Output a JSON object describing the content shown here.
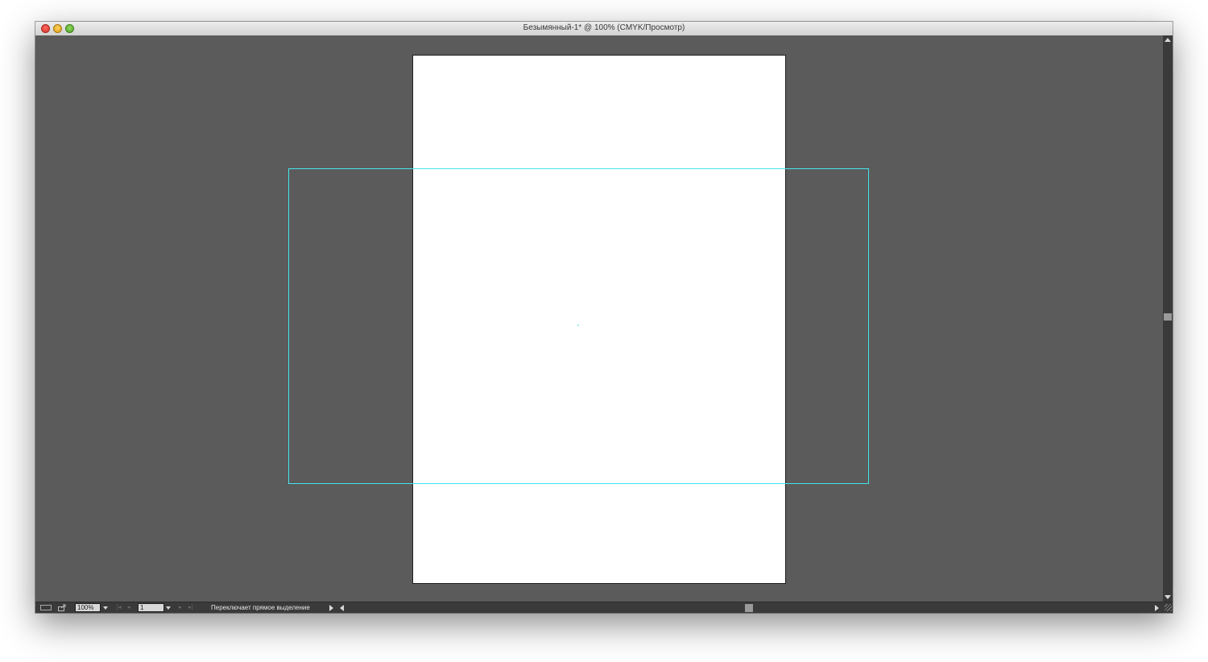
{
  "window": {
    "title": "Безымянный-1* @ 100% (CMYK/Просмотр)"
  },
  "statusbar": {
    "zoom_value": "100%",
    "page_value": "1",
    "status_text": "Переключает прямое выделение"
  },
  "icons": {
    "artboard_tool": "artboard-navigator-icon",
    "export": "share-export-icon",
    "first_page": "first-page-icon",
    "prev_page": "previous-page-icon",
    "next_page": "next-page-icon",
    "last_page": "last-page-icon"
  },
  "colors": {
    "canvas_background": "#5b5b5b",
    "artboard_fill": "#ffffff",
    "selection_outline": "#47e4ea",
    "chrome_dark": "#3a3a3a"
  }
}
